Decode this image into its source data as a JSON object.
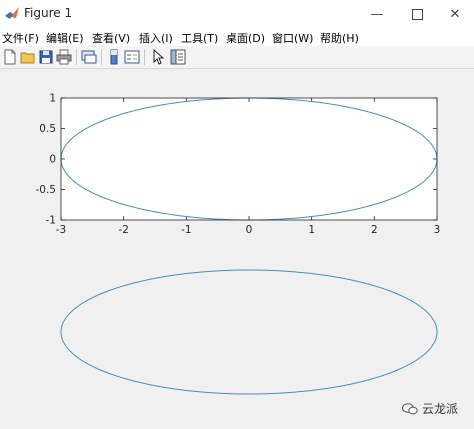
{
  "window": {
    "title": "Figure 1"
  },
  "menu": [
    {
      "label": "文件(F)"
    },
    {
      "label": "编辑(E)"
    },
    {
      "label": "查看(V)"
    },
    {
      "label": "插入(I)"
    },
    {
      "label": "工具(T)"
    },
    {
      "label": "桌面(D)"
    },
    {
      "label": "窗口(W)"
    },
    {
      "label": "帮助(H)"
    }
  ],
  "toolbar": {
    "icons": [
      "new-figure-icon",
      "open-file-icon",
      "save-icon",
      "print-icon",
      "link-plot-icon",
      "insert-colorbar-icon",
      "insert-legend-icon",
      "pointer-icon",
      "property-editor-icon"
    ]
  },
  "colors": {
    "curve": "#4a8db8",
    "axes_bg": "#ffffff",
    "figure_bg": "#f0f0f0"
  },
  "chart_data": [
    {
      "type": "line",
      "description_of_curve": "ellipse x=3cos(t), y=sin(t)",
      "x_ticks": [
        "-3",
        "-2",
        "-1",
        "0",
        "1",
        "2",
        "3"
      ],
      "y_ticks": [
        "-1",
        "-0.5",
        "0",
        "0.5",
        "1"
      ],
      "xlim": [
        -3,
        3
      ],
      "ylim": [
        -1,
        1
      ],
      "axis_visible": true,
      "series": [
        {
          "semi_axis_x": 3,
          "semi_axis_y": 1,
          "center": [
            0,
            0
          ]
        }
      ]
    },
    {
      "type": "line",
      "axis_visible": false,
      "series": [
        {
          "semi_axis_x": 3,
          "semi_axis_y": 1,
          "center": [
            0,
            0
          ]
        }
      ]
    }
  ],
  "watermark": {
    "text": "云龙派"
  }
}
